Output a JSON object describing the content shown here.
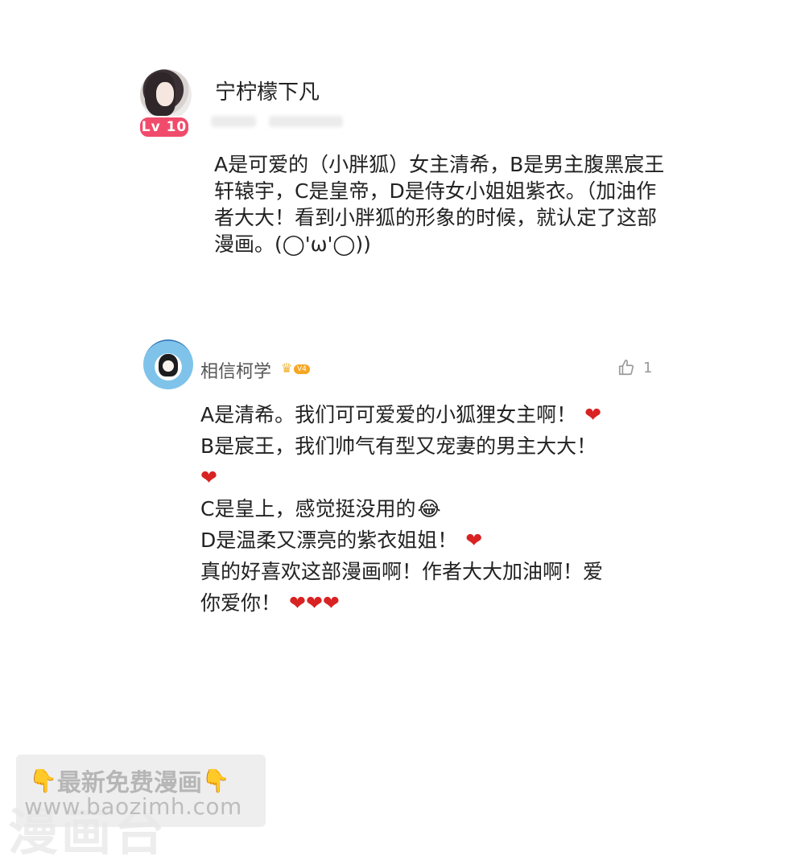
{
  "comments": [
    {
      "username": "宁柠檬下凡",
      "level_badge": "Lv 10",
      "text": "A是可爱的（小胖狐）女主清希，B是男主腹黑宸王轩辕宇，C是皇帝，D是侍女小姐姐紫衣。（加油作者大大！看到小胖狐的形象的时候，就认定了这部漫画。(◯'ω'◯))"
    },
    {
      "username": "相信柯学",
      "vip_badge": "V4",
      "like_count": "1",
      "lines": [
        {
          "text": "A是清希。我们可可爱爱的小狐狸女主啊！",
          "emoji": "❤"
        },
        {
          "text": "B是宸王，我们帅气有型又宠妻的男主大大！"
        },
        {
          "text": "",
          "emoji": "❤"
        },
        {
          "text": "C是皇上，感觉挺没用的",
          "emoji": "😂"
        },
        {
          "text": "D是温柔又漂亮的紫衣姐姐！",
          "emoji": "❤"
        },
        {
          "text": "真的好喜欢这部漫画啊！作者大大加油啊！爱"
        },
        {
          "text": "你爱你！",
          "emoji": "❤❤❤"
        }
      ]
    }
  ],
  "watermark": {
    "pointer_icon": "👇",
    "title": "最新免费漫画",
    "url": "www.baozimh.com",
    "ghost_text": "漫画台"
  },
  "colors": {
    "heart": "#d92222",
    "level_badge": "#f14b6b",
    "vip_badge": "#f6a623"
  }
}
